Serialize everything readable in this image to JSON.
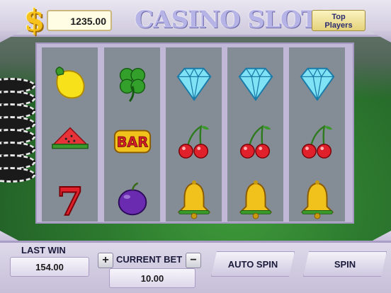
{
  "header": {
    "currency_symbol": "$",
    "balance": "1235.00",
    "title": "CASINO SLOTS",
    "top_players_line1": "Top",
    "top_players_line2": "Players"
  },
  "reels": [
    [
      "lemon-icon",
      "watermelon-icon",
      "seven-icon"
    ],
    [
      "clover-icon",
      "bar-icon",
      "plum-icon"
    ],
    [
      "diamond-icon",
      "cherry-icon",
      "bell-icon"
    ],
    [
      "diamond-icon",
      "cherry-icon",
      "bell-icon"
    ],
    [
      "diamond-icon",
      "cherry-icon",
      "bell-icon"
    ]
  ],
  "bar_text": "BAR",
  "seven_text": "7",
  "footer": {
    "last_win_label": "LAST WIN",
    "last_win_value": "154.00",
    "plus": "+",
    "minus": "−",
    "current_bet_label": "CURRENT BET",
    "current_bet_value": "10.00",
    "auto_spin": "AUTO SPIN",
    "spin": "SPIN"
  },
  "colors": {
    "accent_gold": "#f6c21b",
    "title_lavender": "#b6b4e6",
    "panel_lavender": "#cfc9dd"
  }
}
